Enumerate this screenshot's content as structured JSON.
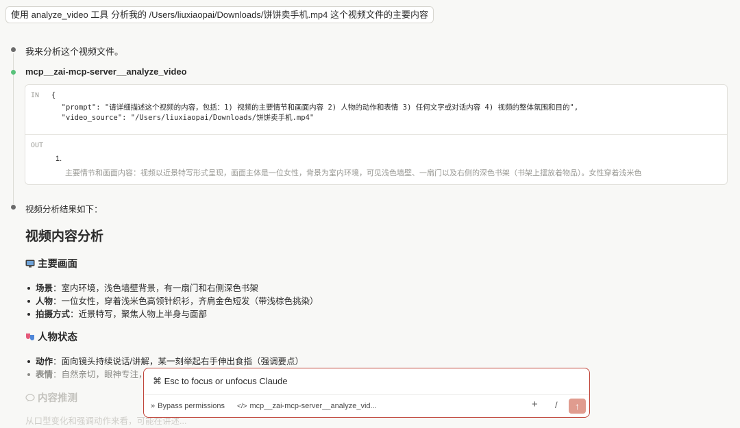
{
  "prompt": "使用 analyze_video 工具 分析我的 /Users/liuxiaopai/Downloads/饼饼卖手机.mp4  这个视频文件的主要内容",
  "messages": {
    "intro": "我来分析这个视频文件。",
    "tool_name": "mcp__zai-mcp-server__analyze_video",
    "result_intro": "视频分析结果如下："
  },
  "tool_call": {
    "in_label": "IN",
    "out_label": "OUT",
    "code_open": "{",
    "code_line1": "  \"prompt\": \"请详细描述这个视频的内容，包括：1) 视频的主要情节和画面内容 2) 人物的动作和表情 3) 任何文字或对话内容 4) 视频的整体氛围和目的\",",
    "code_line2": "  \"video_source\": \"/Users/liuxiaopai/Downloads/饼饼卖手机.mp4\"",
    "out_number": "1.",
    "out_text": "主要情节和画面内容：视频以近景特写形式呈现，画面主体是一位女性，背景为室内环境，可见浅色墙壁、一扇门以及右侧的深色书架（书架上摆放着物品）。女性穿着浅米色"
  },
  "analysis": {
    "title": "视频内容分析",
    "section1": {
      "heading": "主要画面",
      "items": [
        {
          "label": "场景",
          "text": "：室内环境，浅色墙壁背景，有一扇门和右侧深色书架"
        },
        {
          "label": "人物",
          "text": "：一位女性，穿着浅米色高领针织衫，齐肩金色短发（带浅棕色挑染）"
        },
        {
          "label": "拍摄方式",
          "text": "：近景特写，聚焦人物上半身与面部"
        }
      ]
    },
    "section2": {
      "heading": "人物状态",
      "items": [
        {
          "label": "动作",
          "text": "：面向镜头持续说话/讲解，某一刻举起右手伸出食指（强调要点）"
        },
        {
          "label": "表情",
          "text": "：自然亲切，眼神专注，"
        }
      ]
    },
    "section3": {
      "heading": "内容推测",
      "text": "从口型变化和强调动作来看，可能在讲述..."
    }
  },
  "input": {
    "placeholder": "⌘ Esc to focus or unfocus Claude",
    "bypass": "Bypass permissions",
    "tool_chip": "mcp__zai-mcp-server__analyze_vid...",
    "plus": "+",
    "slash": "/",
    "send": "↑"
  },
  "colors": {
    "accent_border": "#c0453a",
    "send_button": "#e09c8f",
    "tool_dot": "#59c27b"
  }
}
